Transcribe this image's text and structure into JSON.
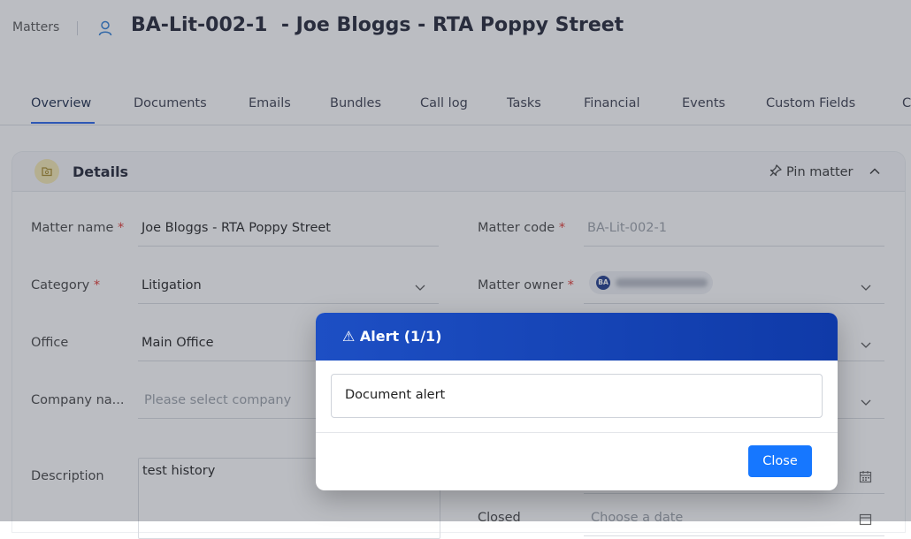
{
  "header": {
    "breadcrumb": "Matters",
    "matter_code": "BA-Lit-002-1",
    "title_rest": "- Joe Bloggs - RTA Poppy Street"
  },
  "tabs": [
    "Overview",
    "Documents",
    "Emails",
    "Bundles",
    "Call log",
    "Tasks",
    "Financial",
    "Events",
    "Custom Fields",
    "C"
  ],
  "details": {
    "title": "Details",
    "pin_label": "Pin matter",
    "fields": {
      "matter_name_label": "Matter name",
      "matter_name_value": "Joe Bloggs - RTA Poppy Street",
      "matter_code_label": "Matter code",
      "matter_code_value": "BA-Lit-002-1",
      "category_label": "Category",
      "category_value": "Litigation",
      "matter_owner_label": "Matter owner",
      "owner_initials": "BA",
      "office_label": "Office",
      "office_value": "Main Office",
      "company_label": "Company na...",
      "company_placeholder": "Please select company",
      "description_label": "Description",
      "description_value": "test history",
      "closed_label": "Closed",
      "closed_placeholder": "Choose a date"
    }
  },
  "modal": {
    "title": "⚠ Alert (1/1)",
    "message": "Document alert",
    "close_label": "Close"
  },
  "colors": {
    "accent": "#1677ff",
    "modal_header": "#1d4fc4",
    "required": "#e0342f"
  }
}
